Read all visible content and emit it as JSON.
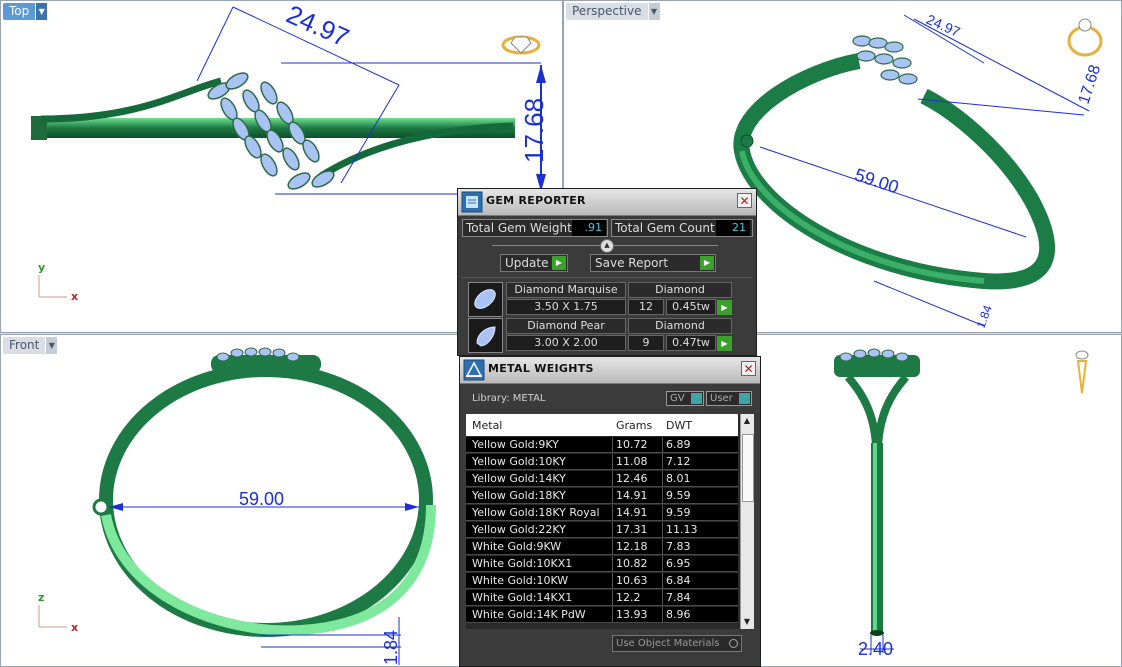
{
  "viewports": {
    "top": {
      "title": "Top",
      "dim_width": "24.97",
      "dim_height": "17.68",
      "axis1": "y",
      "axis2": "x"
    },
    "perspective": {
      "title": "Perspective",
      "dim_width": "24.97",
      "dim_height": "17.68",
      "dim_diameter": "59.00",
      "dim_small": "1.84"
    },
    "front": {
      "title": "Front",
      "dim_diameter": "59.00",
      "dim_thickness": "1.84",
      "axis1": "z",
      "axis2": "x"
    },
    "right": {
      "dim_width": "2.40"
    }
  },
  "gem_reporter": {
    "title": "GEM REPORTER",
    "weight_label": "Total Gem Weight",
    "weight_value": ".91",
    "count_label": "Total Gem Count",
    "count_value": "21",
    "update_label": "Update",
    "save_label": "Save Report",
    "gems": [
      {
        "shape": "Diamond Marquise",
        "material": "Diamond",
        "size": "3.50 X 1.75",
        "count": "12",
        "tw": "0.45tw"
      },
      {
        "shape": "Diamond Pear",
        "material": "Diamond",
        "size": "3.00 X 2.00",
        "count": "9",
        "tw": "0.47tw"
      }
    ]
  },
  "metal_weights": {
    "title": "METAL WEIGHTS",
    "library_label": "Library: METAL",
    "toggle_gv": "GV",
    "toggle_user": "User",
    "headers": [
      "Metal",
      "Grams",
      "DWT"
    ],
    "rows": [
      [
        "Yellow Gold:9KY",
        "10.72",
        "6.89"
      ],
      [
        "Yellow Gold:10KY",
        "11.08",
        "7.12"
      ],
      [
        "Yellow Gold:14KY",
        "12.46",
        "8.01"
      ],
      [
        "Yellow Gold:18KY",
        "14.91",
        "9.59"
      ],
      [
        "Yellow Gold:18KY Royal",
        "14.91",
        "9.59"
      ],
      [
        "Yellow Gold:22KY",
        "17.31",
        "11.13"
      ],
      [
        "White Gold:9KW",
        "12.18",
        "7.83"
      ],
      [
        "White Gold:10KX1",
        "10.82",
        "6.95"
      ],
      [
        "White Gold:10KW",
        "10.63",
        "6.84"
      ],
      [
        "White Gold:14KX1",
        "12.2",
        "7.84"
      ],
      [
        "White Gold:14K PdW",
        "13.93",
        "8.96"
      ]
    ],
    "use_materials_label": "Use Object Materials"
  }
}
